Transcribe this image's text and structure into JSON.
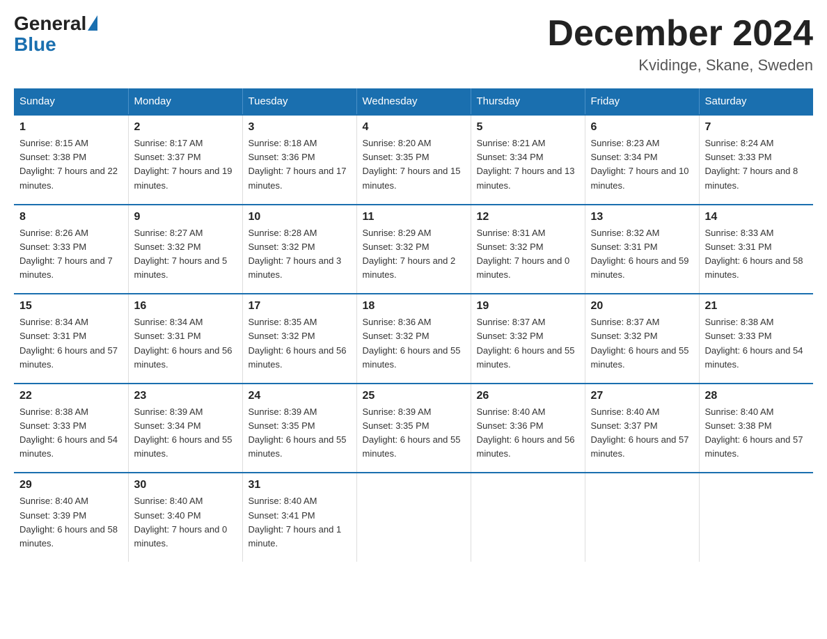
{
  "header": {
    "logo_general": "General",
    "logo_blue": "Blue",
    "month_title": "December 2024",
    "location": "Kvidinge, Skane, Sweden"
  },
  "days_of_week": [
    "Sunday",
    "Monday",
    "Tuesday",
    "Wednesday",
    "Thursday",
    "Friday",
    "Saturday"
  ],
  "weeks": [
    [
      {
        "day": "1",
        "sunrise": "8:15 AM",
        "sunset": "3:38 PM",
        "daylight": "7 hours and 22 minutes."
      },
      {
        "day": "2",
        "sunrise": "8:17 AM",
        "sunset": "3:37 PM",
        "daylight": "7 hours and 19 minutes."
      },
      {
        "day": "3",
        "sunrise": "8:18 AM",
        "sunset": "3:36 PM",
        "daylight": "7 hours and 17 minutes."
      },
      {
        "day": "4",
        "sunrise": "8:20 AM",
        "sunset": "3:35 PM",
        "daylight": "7 hours and 15 minutes."
      },
      {
        "day": "5",
        "sunrise": "8:21 AM",
        "sunset": "3:34 PM",
        "daylight": "7 hours and 13 minutes."
      },
      {
        "day": "6",
        "sunrise": "8:23 AM",
        "sunset": "3:34 PM",
        "daylight": "7 hours and 10 minutes."
      },
      {
        "day": "7",
        "sunrise": "8:24 AM",
        "sunset": "3:33 PM",
        "daylight": "7 hours and 8 minutes."
      }
    ],
    [
      {
        "day": "8",
        "sunrise": "8:26 AM",
        "sunset": "3:33 PM",
        "daylight": "7 hours and 7 minutes."
      },
      {
        "day": "9",
        "sunrise": "8:27 AM",
        "sunset": "3:32 PM",
        "daylight": "7 hours and 5 minutes."
      },
      {
        "day": "10",
        "sunrise": "8:28 AM",
        "sunset": "3:32 PM",
        "daylight": "7 hours and 3 minutes."
      },
      {
        "day": "11",
        "sunrise": "8:29 AM",
        "sunset": "3:32 PM",
        "daylight": "7 hours and 2 minutes."
      },
      {
        "day": "12",
        "sunrise": "8:31 AM",
        "sunset": "3:32 PM",
        "daylight": "7 hours and 0 minutes."
      },
      {
        "day": "13",
        "sunrise": "8:32 AM",
        "sunset": "3:31 PM",
        "daylight": "6 hours and 59 minutes."
      },
      {
        "day": "14",
        "sunrise": "8:33 AM",
        "sunset": "3:31 PM",
        "daylight": "6 hours and 58 minutes."
      }
    ],
    [
      {
        "day": "15",
        "sunrise": "8:34 AM",
        "sunset": "3:31 PM",
        "daylight": "6 hours and 57 minutes."
      },
      {
        "day": "16",
        "sunrise": "8:34 AM",
        "sunset": "3:31 PM",
        "daylight": "6 hours and 56 minutes."
      },
      {
        "day": "17",
        "sunrise": "8:35 AM",
        "sunset": "3:32 PM",
        "daylight": "6 hours and 56 minutes."
      },
      {
        "day": "18",
        "sunrise": "8:36 AM",
        "sunset": "3:32 PM",
        "daylight": "6 hours and 55 minutes."
      },
      {
        "day": "19",
        "sunrise": "8:37 AM",
        "sunset": "3:32 PM",
        "daylight": "6 hours and 55 minutes."
      },
      {
        "day": "20",
        "sunrise": "8:37 AM",
        "sunset": "3:32 PM",
        "daylight": "6 hours and 55 minutes."
      },
      {
        "day": "21",
        "sunrise": "8:38 AM",
        "sunset": "3:33 PM",
        "daylight": "6 hours and 54 minutes."
      }
    ],
    [
      {
        "day": "22",
        "sunrise": "8:38 AM",
        "sunset": "3:33 PM",
        "daylight": "6 hours and 54 minutes."
      },
      {
        "day": "23",
        "sunrise": "8:39 AM",
        "sunset": "3:34 PM",
        "daylight": "6 hours and 55 minutes."
      },
      {
        "day": "24",
        "sunrise": "8:39 AM",
        "sunset": "3:35 PM",
        "daylight": "6 hours and 55 minutes."
      },
      {
        "day": "25",
        "sunrise": "8:39 AM",
        "sunset": "3:35 PM",
        "daylight": "6 hours and 55 minutes."
      },
      {
        "day": "26",
        "sunrise": "8:40 AM",
        "sunset": "3:36 PM",
        "daylight": "6 hours and 56 minutes."
      },
      {
        "day": "27",
        "sunrise": "8:40 AM",
        "sunset": "3:37 PM",
        "daylight": "6 hours and 57 minutes."
      },
      {
        "day": "28",
        "sunrise": "8:40 AM",
        "sunset": "3:38 PM",
        "daylight": "6 hours and 57 minutes."
      }
    ],
    [
      {
        "day": "29",
        "sunrise": "8:40 AM",
        "sunset": "3:39 PM",
        "daylight": "6 hours and 58 minutes."
      },
      {
        "day": "30",
        "sunrise": "8:40 AM",
        "sunset": "3:40 PM",
        "daylight": "7 hours and 0 minutes."
      },
      {
        "day": "31",
        "sunrise": "8:40 AM",
        "sunset": "3:41 PM",
        "daylight": "7 hours and 1 minute."
      },
      null,
      null,
      null,
      null
    ]
  ]
}
